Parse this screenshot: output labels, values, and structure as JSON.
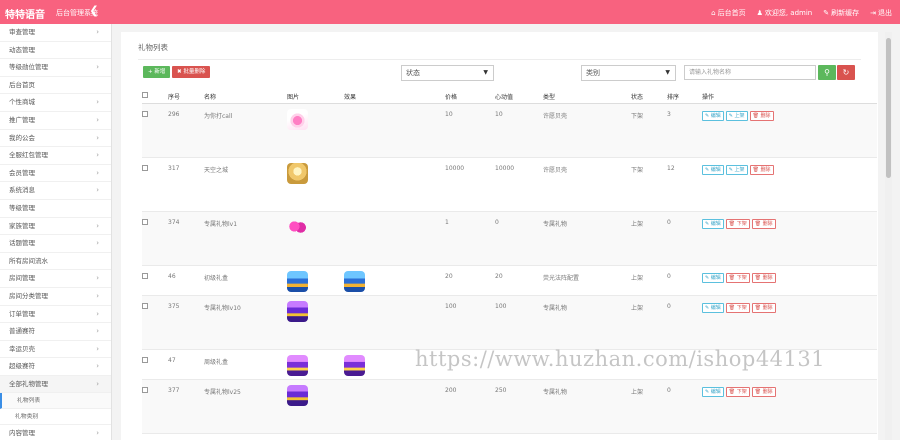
{
  "topbar": {
    "brand": "特特语音",
    "subtitle": "后台管理系统",
    "toggle": "❮",
    "nav": [
      {
        "icon": "home-icon",
        "glyph": "⌂",
        "label": "后台首页"
      },
      {
        "icon": "users-icon",
        "glyph": "♟",
        "label": "欢迎您, admin"
      },
      {
        "icon": "brush-icon",
        "glyph": "✎",
        "label": "刷新缓存"
      },
      {
        "icon": "logout-icon",
        "glyph": "⇥",
        "label": "退出"
      }
    ],
    "bg_color": "#f8627f"
  },
  "sidebar": {
    "items": [
      {
        "label": "审查管理",
        "chev": true
      },
      {
        "label": "动态管理",
        "chev": false
      },
      {
        "label": "等级勋位管理",
        "chev": true
      },
      {
        "label": "后台首页",
        "chev": false
      },
      {
        "label": "个性商城",
        "chev": true
      },
      {
        "label": "推广管理",
        "chev": true
      },
      {
        "label": "我的公会",
        "chev": true
      },
      {
        "label": "全服红包管理",
        "chev": true
      },
      {
        "label": "会员管理",
        "chev": true
      },
      {
        "label": "系统消息",
        "chev": true
      },
      {
        "label": "等级管理",
        "chev": false
      },
      {
        "label": "家族管理",
        "chev": true
      },
      {
        "label": "话题管理",
        "chev": true
      },
      {
        "label": "所有房间流水",
        "chev": false
      },
      {
        "label": "房间管理",
        "chev": true
      },
      {
        "label": "房间分类管理",
        "chev": true
      },
      {
        "label": "订单管理",
        "chev": true
      },
      {
        "label": "普通赛符",
        "chev": true
      },
      {
        "label": "幸运贝壳",
        "chev": true
      },
      {
        "label": "超级赛符",
        "chev": true
      },
      {
        "label": "全部礼物管理",
        "chev": true
      }
    ],
    "subitems": [
      {
        "label": "礼物列表"
      },
      {
        "label": "礼物类别"
      }
    ],
    "after": [
      {
        "label": "内容管理",
        "chev": true
      }
    ]
  },
  "page": {
    "title": "礼物列表",
    "add_label": "+ 新增",
    "batch_delete_label": "✖ 批量删除",
    "status_select": "状态",
    "category_select": "类别",
    "search_placeholder": "请输入礼物名称",
    "search_glyph": "⚲",
    "refresh_glyph": "↻",
    "accent": "#3a8ee6",
    "green": "#5cb85c",
    "red": "#d9534f"
  },
  "table": {
    "headers": [
      "序号",
      "名称",
      "图片",
      "效果",
      "价格",
      "心动值",
      "类型",
      "状态",
      "排序",
      "操作"
    ],
    "rows": [
      {
        "id": "296",
        "name": "为你打call",
        "img": "pink",
        "effect": "",
        "price": "10",
        "heart": "10",
        "type": "许愿贝壳",
        "status": "下架",
        "sort": "3",
        "actions": [
          "✎ 编辑",
          "✎ 上架",
          "🗑 删除"
        ]
      },
      {
        "id": "317",
        "name": "天空之城",
        "img": "gold",
        "effect": "",
        "price": "10000",
        "heart": "10000",
        "type": "许愿贝壳",
        "status": "下架",
        "sort": "12",
        "actions": [
          "✎ 编辑",
          "✎ 上架",
          "🗑 删除"
        ]
      },
      {
        "id": "374",
        "name": "专属礼物lv1",
        "img": "heart",
        "effect": "",
        "price": "1",
        "heart": "0",
        "type": "专属礼物",
        "status": "上架",
        "sort": "0",
        "actions": [
          "✎ 编辑",
          "🗑 下架",
          "🗑 删除"
        ]
      },
      {
        "id": "46",
        "name": "初级礼盒",
        "img": "chest-blue",
        "effect": "chest-blue",
        "price": "20",
        "heart": "20",
        "type": "荧光法阵配置",
        "status": "上架",
        "sort": "0",
        "actions": [
          "✎ 编辑",
          "🗑 下架",
          "🗑 删除"
        ]
      },
      {
        "id": "375",
        "name": "专属礼物lv10",
        "img": "chest-purple",
        "effect": "",
        "price": "100",
        "heart": "100",
        "type": "专属礼物",
        "status": "上架",
        "sort": "0",
        "actions": [
          "✎ 编辑",
          "🗑 下架",
          "🗑 删除"
        ]
      },
      {
        "id": "47",
        "name": "周级礼盒",
        "img": "chest-purple2",
        "effect": "chest-purple2",
        "price": "",
        "heart": "",
        "type": "",
        "status": "",
        "sort": "",
        "actions": []
      },
      {
        "id": "377",
        "name": "专属礼物lv25",
        "img": "chest-purple",
        "effect": "",
        "price": "200",
        "heart": "250",
        "type": "专属礼物",
        "status": "上架",
        "sort": "0",
        "actions": [
          "✎ 编辑",
          "🗑 下架",
          "🗑 删除"
        ]
      }
    ]
  },
  "watermark": "https://www.huzhan.com/ishop44131"
}
